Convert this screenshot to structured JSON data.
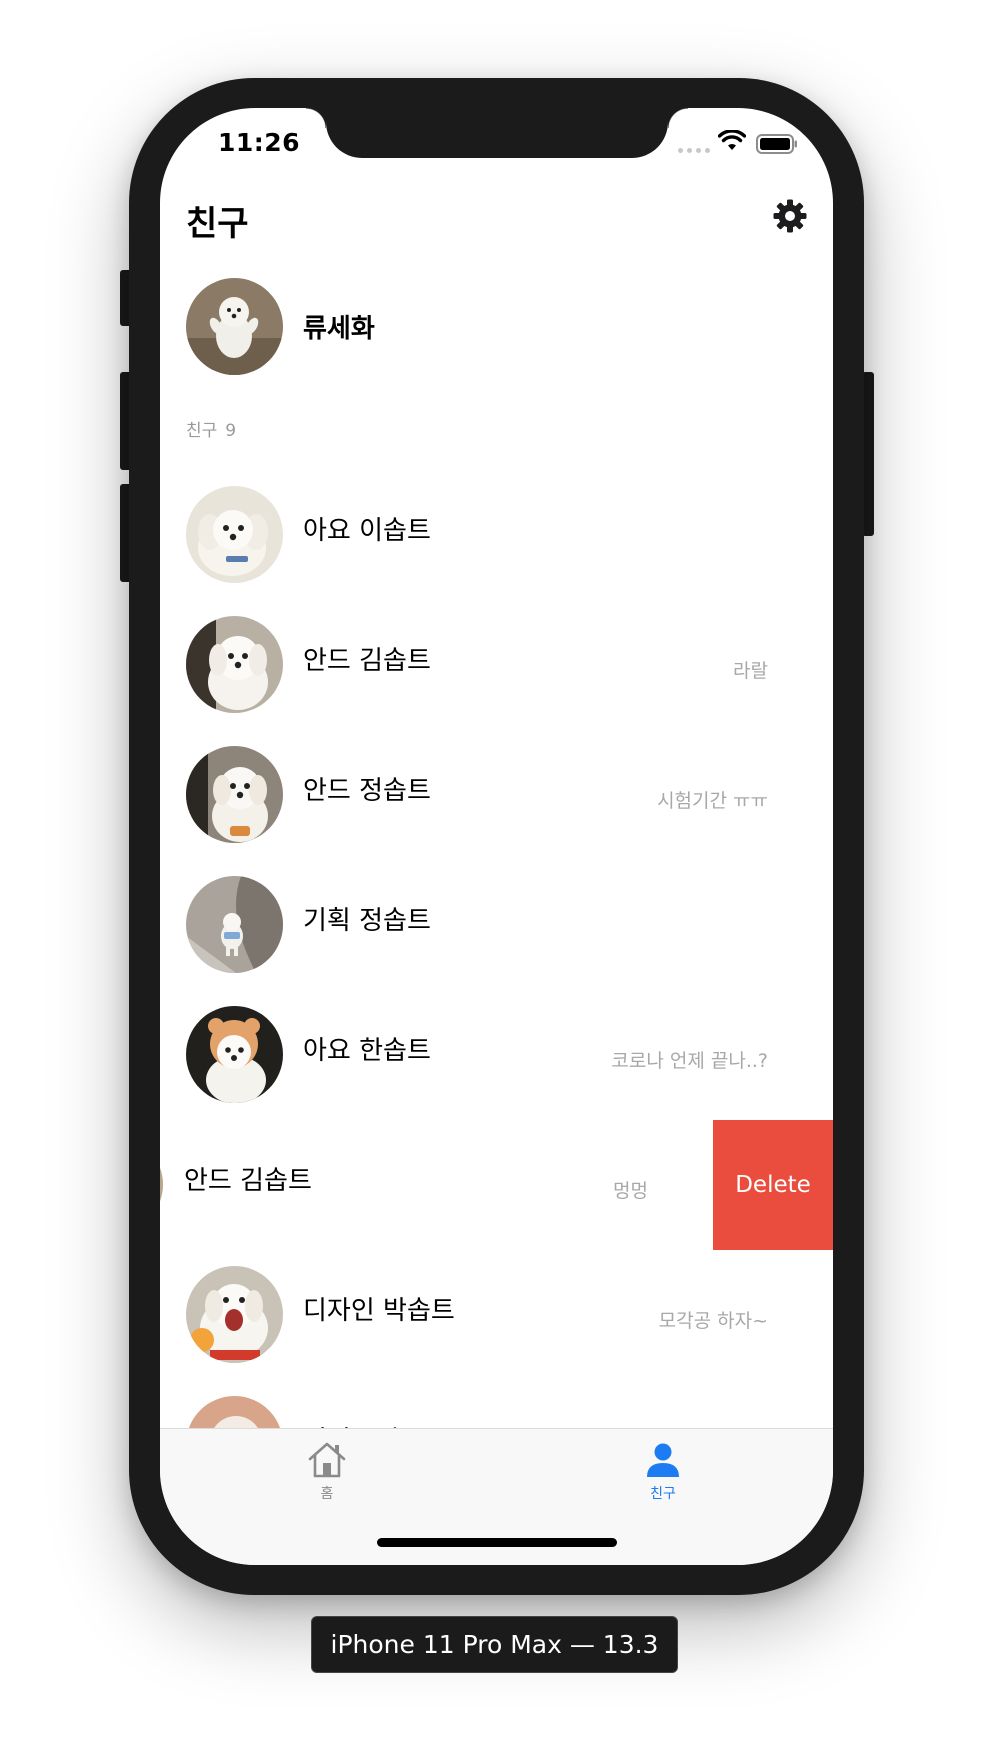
{
  "status_bar": {
    "time": "11:26"
  },
  "header": {
    "title": "친구"
  },
  "my_profile": {
    "name": "류세화"
  },
  "section": {
    "label": "친구",
    "count": "9"
  },
  "friends": [
    {
      "name": "아요 이솝트",
      "message": ""
    },
    {
      "name": "안드 김솝트",
      "message": "라랄"
    },
    {
      "name": "안드 정솝트",
      "message": "시험기간 ㅠㅠ"
    },
    {
      "name": "기획 정솝트",
      "message": ""
    },
    {
      "name": "아요 한솝트",
      "message": "코로나 언제 끝나..?"
    },
    {
      "name": "안드 김솝트",
      "message": "멍멍",
      "swiped": true,
      "action": "Delete"
    },
    {
      "name": "디자인 박솝트",
      "message": "모각공 하자~"
    },
    {
      "name": "서버 유솝트",
      "message": ""
    }
  ],
  "tabbar": {
    "home": {
      "label": "홈",
      "icon": "home-icon"
    },
    "friends": {
      "label": "친구",
      "icon": "person-icon",
      "active": true
    }
  },
  "device_caption": "iPhone 11 Pro Max — 13.3",
  "colors": {
    "delete": "#ea4d3d",
    "accent": "#1e7cf2"
  }
}
